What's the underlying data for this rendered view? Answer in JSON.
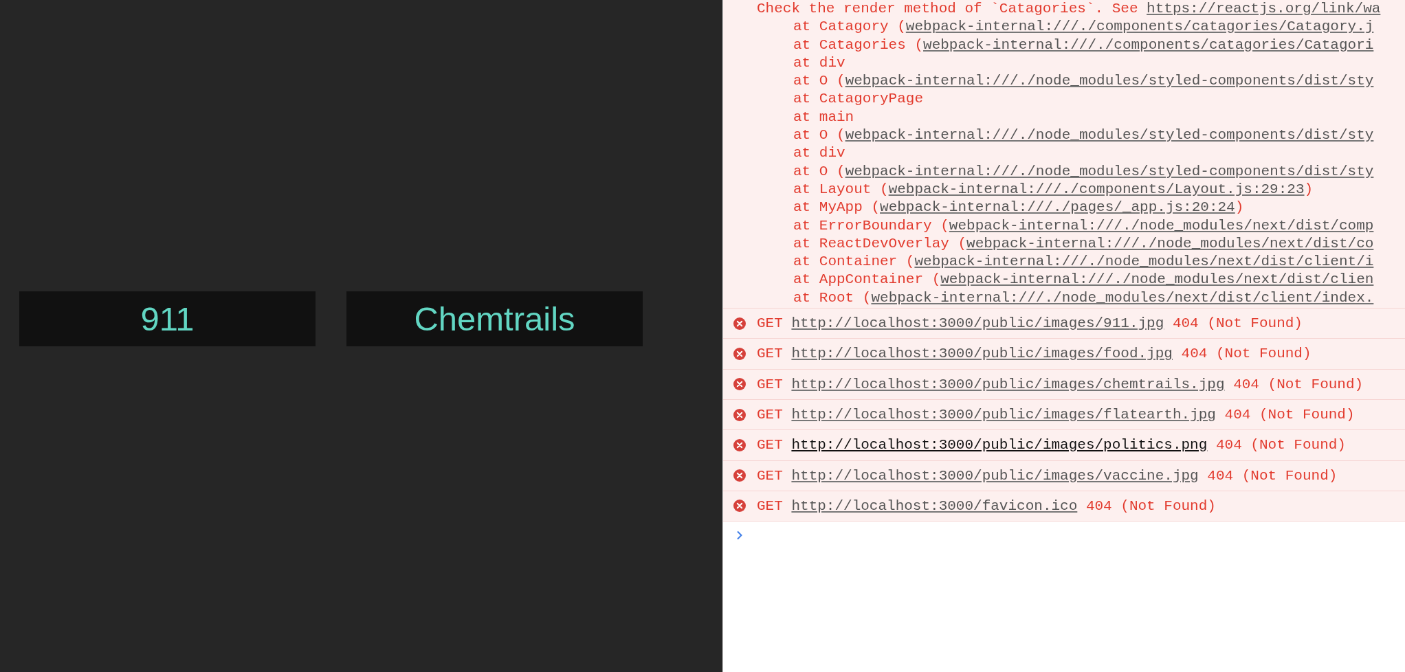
{
  "page": {
    "categories": [
      {
        "label": "911"
      },
      {
        "label": "Chemtrails"
      }
    ]
  },
  "console": {
    "trace": [
      {
        "kind": "message",
        "text": "Check the render method of `Catagories`. See ",
        "link": "https://reactjs.org/link/wa"
      },
      {
        "kind": "frame",
        "text": "at Catagory (",
        "link": "webpack-internal:///./components/catagories/Catagory.j"
      },
      {
        "kind": "frame",
        "text": "at Catagories (",
        "link": "webpack-internal:///./components/catagories/Catagori"
      },
      {
        "kind": "frame",
        "text": "at div"
      },
      {
        "kind": "frame",
        "text": "at O (",
        "link": "webpack-internal:///./node_modules/styled-components/dist/sty"
      },
      {
        "kind": "frame",
        "text": "at CatagoryPage"
      },
      {
        "kind": "frame",
        "text": "at main"
      },
      {
        "kind": "frame",
        "text": "at O (",
        "link": "webpack-internal:///./node_modules/styled-components/dist/sty"
      },
      {
        "kind": "frame",
        "text": "at div"
      },
      {
        "kind": "frame",
        "text": "at O (",
        "link": "webpack-internal:///./node_modules/styled-components/dist/sty"
      },
      {
        "kind": "frame",
        "text": "at Layout (",
        "link": "webpack-internal:///./components/Layout.js:29:23",
        "after": ")"
      },
      {
        "kind": "frame",
        "text": "at MyApp (",
        "link": "webpack-internal:///./pages/_app.js:20:24",
        "after": ")"
      },
      {
        "kind": "frame",
        "text": "at ErrorBoundary (",
        "link": "webpack-internal:///./node_modules/next/dist/comp"
      },
      {
        "kind": "frame",
        "text": "at ReactDevOverlay (",
        "link": "webpack-internal:///./node_modules/next/dist/co"
      },
      {
        "kind": "frame",
        "text": "at Container (",
        "link": "webpack-internal:///./node_modules/next/dist/client/i"
      },
      {
        "kind": "frame",
        "text": "at AppContainer (",
        "link": "webpack-internal:///./node_modules/next/dist/clien"
      },
      {
        "kind": "frame",
        "text": "at Root (",
        "link": "webpack-internal:///./node_modules/next/dist/client/index."
      }
    ],
    "network_errors": [
      {
        "method": "GET",
        "url": "http://localhost:3000/public/images/911.jpg",
        "status": "404 (Not Found)",
        "hovered": false
      },
      {
        "method": "GET",
        "url": "http://localhost:3000/public/images/food.jpg",
        "status": "404 (Not Found)",
        "hovered": false
      },
      {
        "method": "GET",
        "url": "http://localhost:3000/public/images/chemtrails.jpg",
        "status": "404 (Not Found)",
        "hovered": false
      },
      {
        "method": "GET",
        "url": "http://localhost:3000/public/images/flatearth.jpg",
        "status": "404 (Not Found)",
        "hovered": false
      },
      {
        "method": "GET",
        "url": "http://localhost:3000/public/images/politics.png",
        "status": "404 (Not Found)",
        "hovered": true
      },
      {
        "method": "GET",
        "url": "http://localhost:3000/public/images/vaccine.jpg",
        "status": "404 (Not Found)",
        "hovered": false
      },
      {
        "method": "GET",
        "url": "http://localhost:3000/favicon.ico",
        "status": "404 (Not Found)",
        "hovered": false
      }
    ]
  }
}
